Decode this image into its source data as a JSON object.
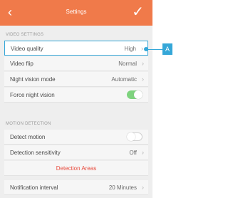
{
  "header": {
    "back_icon": "‹",
    "title": "Settings",
    "check_icon": "✓",
    "background": "#f07a4a"
  },
  "video_settings": {
    "section_label": "VIDEO SETTINGS",
    "rows": [
      {
        "label": "Video quality",
        "value": "High"
      },
      {
        "label": "Video flip",
        "value": "Normal"
      },
      {
        "label": "Night vision mode",
        "value": "Automatic"
      },
      {
        "label": "Force night vision",
        "toggle": "on"
      }
    ]
  },
  "motion_detection": {
    "section_label": "MOTION DETECTION",
    "rows": [
      {
        "label": "Detect motion",
        "toggle": "off"
      },
      {
        "label": "Detection sensitivity",
        "value": "Off"
      },
      {
        "action": "Detection Areas"
      }
    ]
  },
  "notification": {
    "label": "Notification interval",
    "value": "20 Minutes"
  },
  "callout": {
    "label": "A",
    "color": "#35a7d8"
  },
  "colors": {
    "accent": "#f07a4a",
    "toggle_on": "#7ed37e",
    "action_red": "#e84a3c",
    "highlight_blue": "#35a7d8"
  },
  "chevron_icon": "›"
}
